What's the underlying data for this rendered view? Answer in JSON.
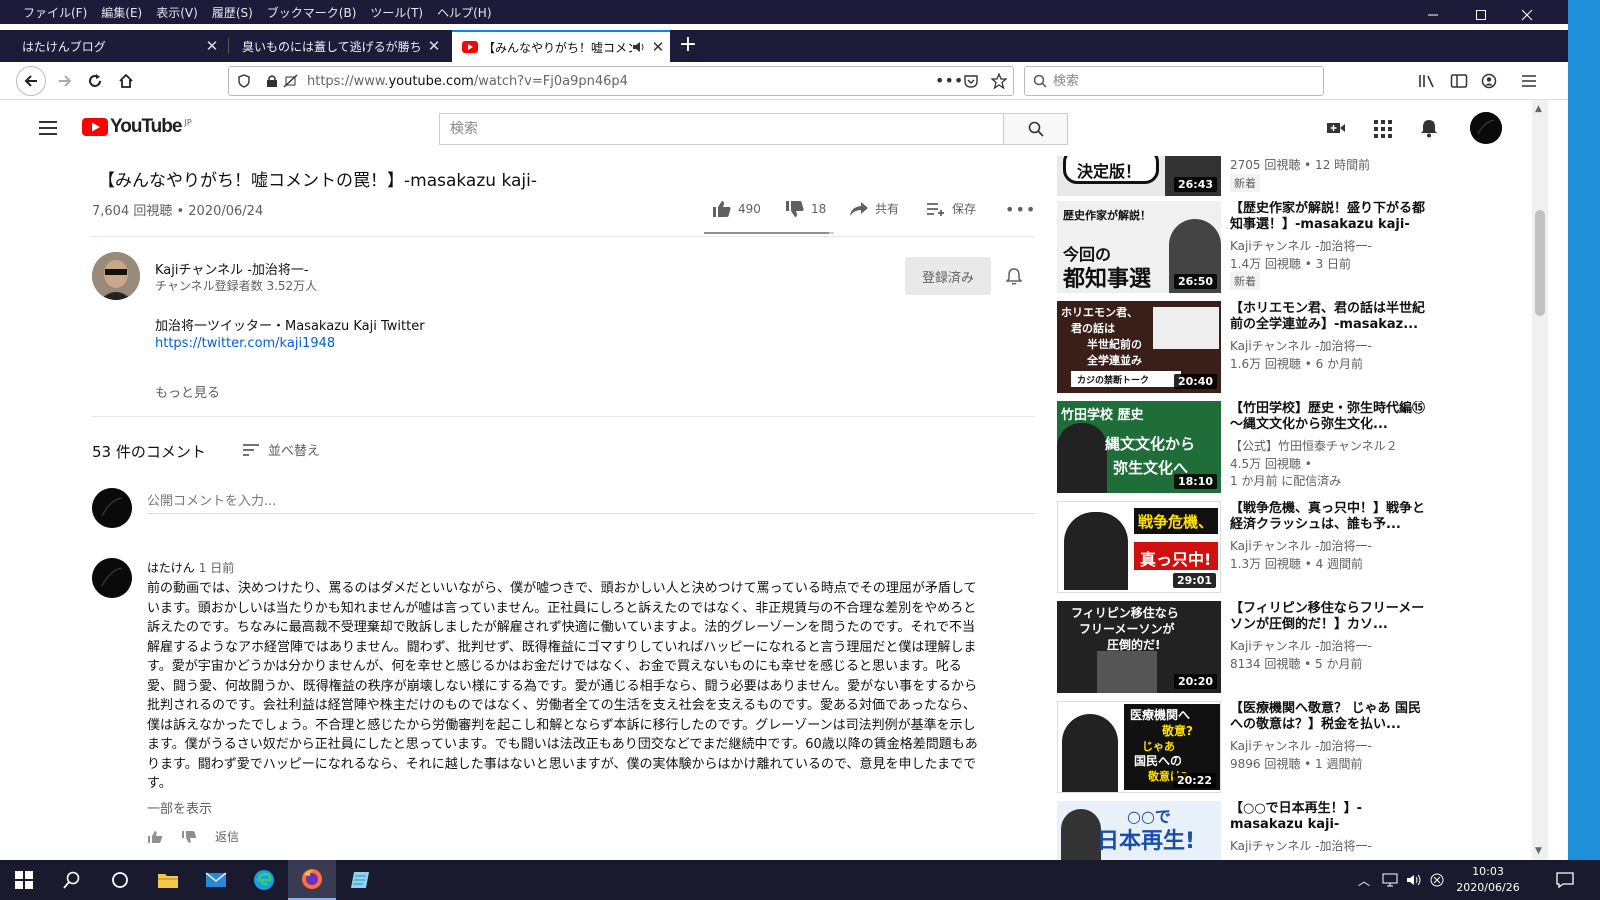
{
  "browser": {
    "menu": [
      "ファイル(F)",
      "編集(E)",
      "表示(V)",
      "履歴(S)",
      "ブックマーク(B)",
      "ツール(T)",
      "ヘルプ(H)"
    ],
    "tabs": [
      {
        "title": "はたけんブログ"
      },
      {
        "title": "臭いものには蓋して逃げるが勝ち: はたけんブログ"
      },
      {
        "title": "【みんなやりがち！嘘コメントの罠！】-masakazu kaji- - YouTube"
      }
    ],
    "url_prefix": "https://www.",
    "url_domain": "youtube.com",
    "url_path": "/watch?v=Fj0a9pn46p4",
    "search_placeholder": "検索"
  },
  "youtube": {
    "logo_text": "YouTube",
    "logo_region": "JP",
    "search_placeholder": "検索",
    "video": {
      "title": "【みんなやりがち！嘘コメントの罠！】-masakazu kaji-",
      "views_date": "7,604 回視聴 • 2020/06/24",
      "likes": "490",
      "dislikes": "18",
      "share": "共有",
      "save": "保存",
      "like_ratio": 0.96
    },
    "channel": {
      "name": "Kajiチャンネル -加治将一-",
      "subscribers": "チャンネル登録者数 3.52万人",
      "subscribed_label": "登録済み"
    },
    "description": {
      "line1": "加治将一ツイッター・Masakazu Kaji Twitter",
      "link": "https://twitter.com/kaji1948",
      "more": "もっと見る"
    },
    "comments": {
      "count": "53 件のコメント",
      "sort": "並べ替え",
      "input_placeholder": "公開コメントを入力...",
      "first": {
        "author": "はたけん",
        "time": "1 日前",
        "text": "前の動画では、決めつけたり、罵るのはダメだといいながら、僕が嘘つきで、頭おかしい人と決めつけて罵っている時点でその理屈が矛盾しています。頭おかしいは当たりかも知れませんが嘘は言っていません。正社員にしろと訴えたのではなく、非正規賃与の不合理な差別をやめろと訴えたのです。ちなみに最高裁不受理棄却で敗訴しましたが解雇されず快適に働いていますよ。法的グレーゾーンを問うたのです。それで不当解雇するようなアホ経営陣ではありません。闘わず、批判せず、既得権益にゴマすりしていればハッピーになれると言う理屈だと僕は理解します。愛が宇宙かどうかは分かりませんが、何を幸せと感じるかはお金だけではなく、お金で買えないものにも幸せを感じると思います。叱る愛、闘う愛、何故闘うか、既得権益の秩序が崩壊しない様にする為です。愛が通じる相手なら、闘う必要はありません。愛がない事をするから批判されるのです。会社利益は経営陣や株主だけのものではなく、労働者全ての生活を支え社会を支えるものです。愛ある対価であったなら、僕は訴えなかったでしょう。不合理と感じたから労働審判を起こし和解とならず本訴に移行したのです。グレーゾーンは司法判例が基準を示します。僕がうるさい奴だから正社員にしたと思っています。でも闘いは法改正もあり団交などでまだ継続中です。60歳以降の賃金格差問題もあります。闘わず愛でハッピーになれるなら、それに越した事はないと思いますが、僕の実体験からはかけ離れているので、意見を申したまでです。",
        "show_more": "一部を表示",
        "reply": "返信"
      }
    },
    "related": [
      {
        "title": "",
        "channel": "",
        "meta": "2705 回視聴 • 12 時間前",
        "badge": "新着",
        "duration": "26:43",
        "thumb_text": "決定版！"
      },
      {
        "title": "【歴史作家が解説！盛り下がる都知事選！】-masakazu kaji-",
        "channel": "Kajiチャンネル -加治将一-",
        "meta": "1.4万 回視聴 • 3 日前",
        "badge": "新着",
        "duration": "26:50",
        "thumb_top": "歴史作家が解説！",
        "thumb_main": "今回の",
        "thumb_main2": "都知事選"
      },
      {
        "title": "【ホリエモン君、君の話は半世紀前の全学連並み】-masakaz...",
        "channel": "Kajiチャンネル -加治将一-",
        "meta": "1.6万 回視聴 • 6 か月前",
        "badge": "",
        "duration": "20:40",
        "thumb_lines": [
          "ホリエモン君、",
          "君の話は",
          "半世紀前の",
          "全学連並み"
        ],
        "thumb_bottom": "カジの禁断トーク"
      },
      {
        "title": "【竹田学校】歴史・弥生時代編⑮～縄文文化から弥生文化...",
        "channel": "【公式】竹田恒泰チャンネル２",
        "meta": "4.5万 回視聴 •",
        "meta2": "1 か月前 に配信済み",
        "badge": "",
        "duration": "18:10",
        "thumb_top": "竹田学校 歴史",
        "thumb_main": "縄文文化から",
        "thumb_main2": "弥生文化へ"
      },
      {
        "title": "【戦争危機、真っ只中！】戦争と経済クラッシュは、誰も予...",
        "channel": "Kajiチャンネル -加治将一-",
        "meta": "1.3万 回視聴 • 4 週間前",
        "badge": "",
        "duration": "29:01",
        "thumb_main": "戦争危機、",
        "thumb_main2": "真っ只中!"
      },
      {
        "title": "【フィリピン移住ならフリーメーソンが圧倒的だ！】カソ...",
        "channel": "Kajiチャンネル -加治将一-",
        "meta": "8134 回視聴 • 5 か月前",
        "badge": "",
        "duration": "20:20",
        "thumb_lines": [
          "フィリピン移住なら",
          "フリーメーソンが",
          "圧倒的だ!"
        ]
      },
      {
        "title": "【医療機関へ敬意？ じゃあ 国民への敬意は？】税金を払い...",
        "channel": "Kajiチャンネル -加治将一-",
        "meta": "9896 回視聴 • 1 週間前",
        "badge": "",
        "duration": "20:22",
        "thumb_lines": [
          "医療機関へ",
          "敬意?",
          "じゃあ",
          "国民への",
          "敬意は?"
        ]
      },
      {
        "title": "【○○で日本再生！】-masakazu kaji-",
        "channel": "Kajiチャンネル -加治将一-",
        "meta": "",
        "badge": "",
        "duration": "",
        "thumb_main": "○○で",
        "thumb_main2": "日本再生!"
      }
    ]
  },
  "taskbar": {
    "time": "10:03",
    "date": "2020/06/26"
  },
  "colors": {
    "chrome_dark": "#1c1b3a",
    "youtube_red": "#ff0000",
    "link_blue": "#065fd4",
    "accent_blue": "#0a84ff"
  }
}
